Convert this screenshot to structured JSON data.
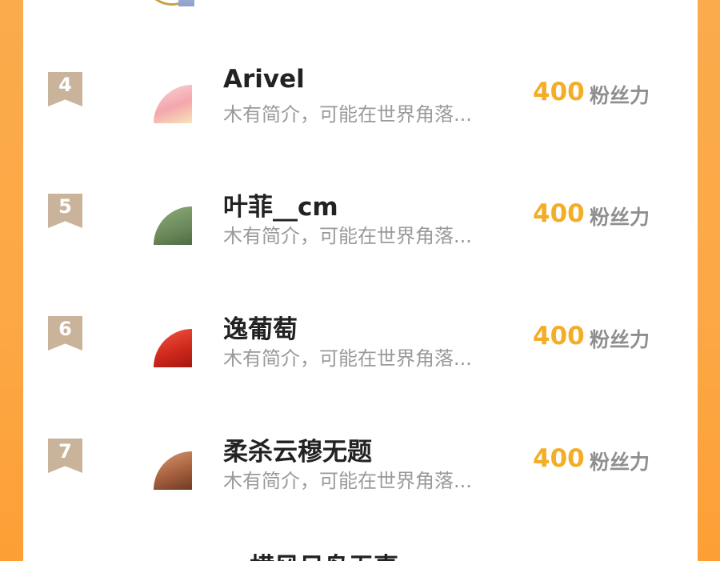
{
  "top": {
    "avatar_icon": "user-avatar-icon"
  },
  "rows": [
    {
      "rank": "4",
      "name": "Arivel",
      "bio": "木有简介，可能在世界角落...",
      "score": "400",
      "score_label": "粉丝力",
      "avatar_colors": [
        "#f7c1c6",
        "#f08a8a"
      ]
    },
    {
      "rank": "5",
      "name": "叶菲__cm",
      "bio": "木有简介，可能在世界角落...",
      "score": "400",
      "score_label": "粉丝力",
      "avatar_colors": [
        "#7c9a6b",
        "#5d7a52"
      ]
    },
    {
      "rank": "6",
      "name": "逸葡萄",
      "bio": "木有简介，可能在世界角落...",
      "score": "400",
      "score_label": "粉丝力",
      "avatar_colors": [
        "#e33a2b",
        "#b51e16"
      ]
    },
    {
      "rank": "7",
      "name": "柔杀云穆无题",
      "bio": "木有简介，可能在世界角落...",
      "score": "400",
      "score_label": "粉丝力",
      "avatar_colors": [
        "#c07a56",
        "#8a4f35"
      ]
    }
  ],
  "bottom_partial_name": "横风日鸟无事",
  "colors": {
    "accent": "#f3ad27",
    "badge": "#c9b39a",
    "background_orange": "#fca846"
  }
}
